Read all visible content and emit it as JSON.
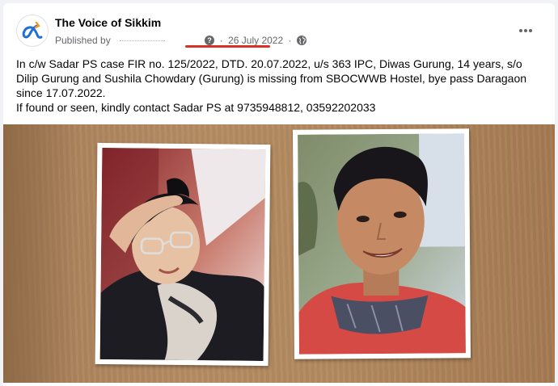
{
  "post": {
    "page_name": "The Voice of Sikkim",
    "published_by_label": "Published by",
    "date": "26 July 2022",
    "body_line1": "In c/w Sadar PS case FIR no.  125/2022, DTD. 20.07.2022, u/s 363 IPC, Diwas Gurung, 14 years, s/o Dilip Gurung and Sushila Chowdary (Gurung) is missing from SBOCWWB Hostel, bye pass Daragaon since 17.07.2022.",
    "body_line2": "If found or seen, kindly contact Sadar PS at 9735948812, 03592202033"
  },
  "icons": {
    "avatar": "page-logo-icon",
    "help": "question-icon",
    "privacy": "globe-icon",
    "more": "more-dots-icon"
  },
  "colors": {
    "accent_underline": "#d93025",
    "logo_blue": "#1f6fd6",
    "logo_orange": "#f29a1f"
  }
}
